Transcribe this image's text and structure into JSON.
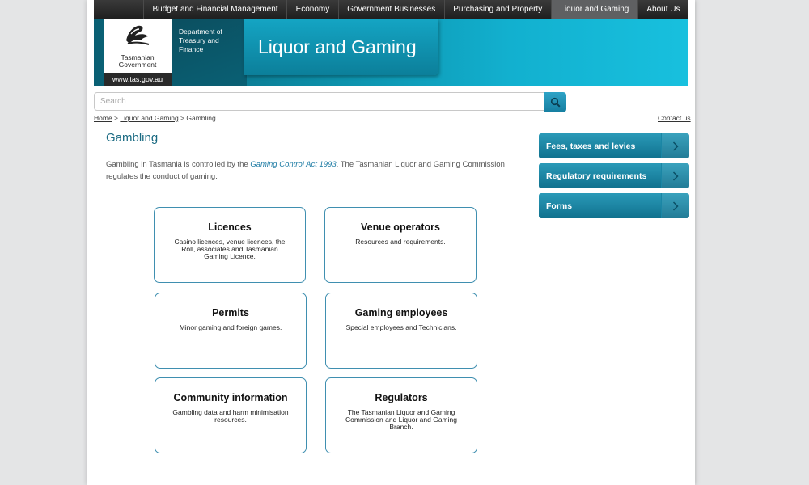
{
  "nav": {
    "items": [
      {
        "label": "Budget and Financial Management"
      },
      {
        "label": "Economy"
      },
      {
        "label": "Government Businesses"
      },
      {
        "label": "Purchasing and Property"
      },
      {
        "label": "Liquor and Gaming",
        "active": true
      },
      {
        "label": "About Us"
      }
    ]
  },
  "banner": {
    "logo_line1": "Tasmanian",
    "logo_line2": "Government",
    "site_url": "www.tas.gov.au",
    "dept_line1": "Department of",
    "dept_line2": "Treasury and",
    "dept_line3": "Finance",
    "title": "Liquor and Gaming"
  },
  "search": {
    "placeholder": "Search"
  },
  "breadcrumb": {
    "home": "Home",
    "sep1": " > ",
    "section": "Liquor and Gaming",
    "sep2": " >  ",
    "current": "Gambling"
  },
  "contact_link": "Contact us",
  "main": {
    "title": "Gambling",
    "intro_before": "Gambling in Tasmania is controlled by the ",
    "intro_act": "Gaming Control Act 1993",
    "intro_after": ". The Tasmanian Liquor and Gaming Commission regulates the conduct of gaming."
  },
  "cards": [
    {
      "title": "Licences",
      "desc": "Casino licences, venue licences, the Roll, associates and Tasmanian Gaming Licence."
    },
    {
      "title": "Venue operators",
      "desc": "Resources and requirements."
    },
    {
      "title": "Permits",
      "desc": "Minor gaming and foreign games."
    },
    {
      "title": "Gaming employees",
      "desc": "Special employees and Technicians."
    },
    {
      "title": "Community information",
      "desc": "Gambling data and harm minimisation resources."
    },
    {
      "title": "Regulators",
      "desc": "The Tasmanian Liquor and Gaming Commission and Liquor and Gaming Branch."
    }
  ],
  "sidebar": {
    "items": [
      {
        "label": "Fees, taxes and levies"
      },
      {
        "label": "Regulatory requirements"
      },
      {
        "label": "Forms"
      }
    ]
  },
  "colors": {
    "accent": "#12a6c6",
    "nav_bg": "#2a2a2a",
    "title": "#1a6a82"
  }
}
